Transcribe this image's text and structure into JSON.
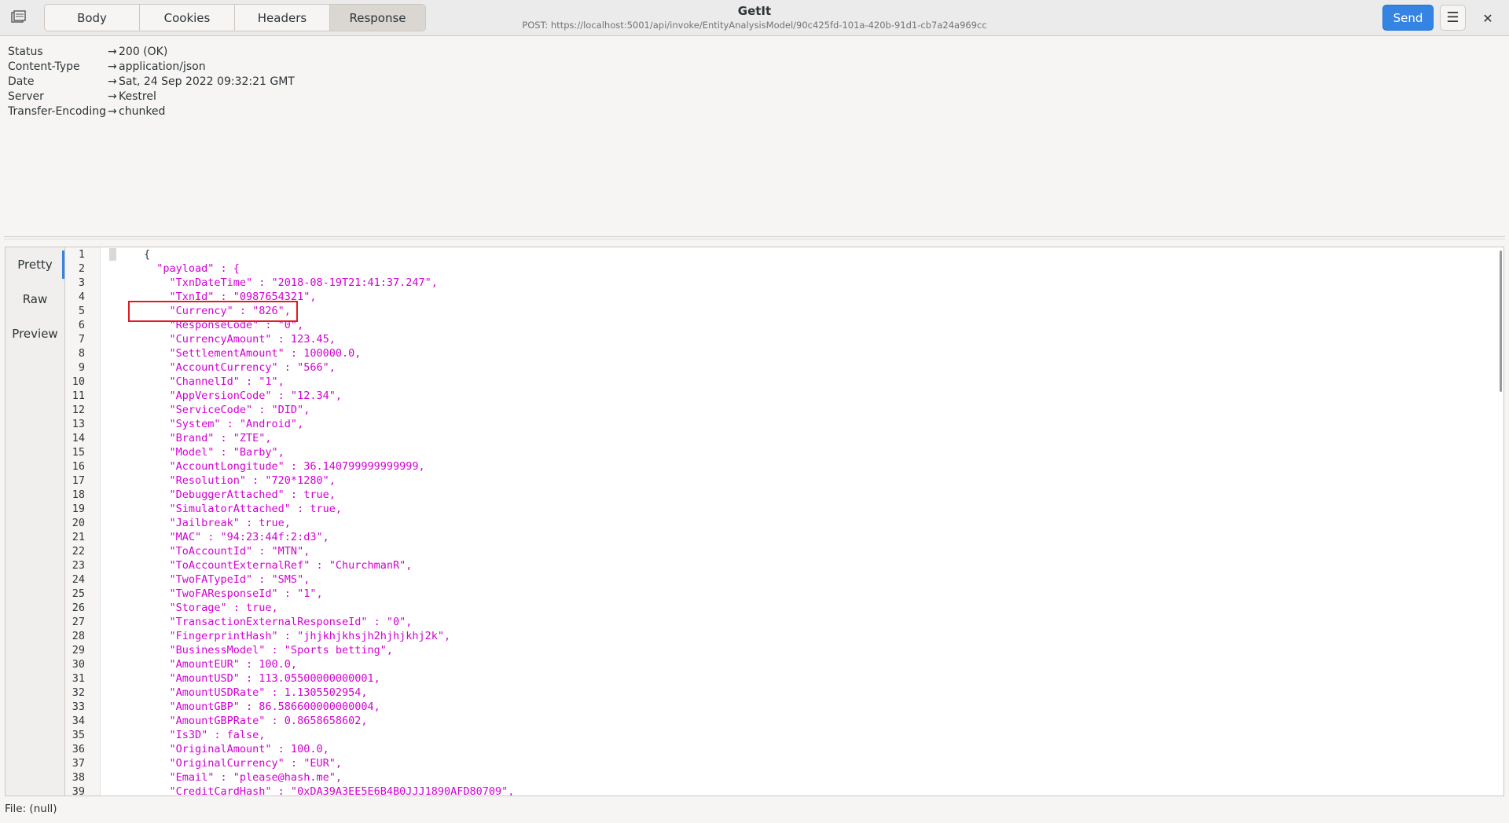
{
  "header": {
    "tabs": [
      "Body",
      "Cookies",
      "Headers",
      "Response"
    ],
    "active_tab": "Response",
    "title": "GetIt",
    "subtitle": "POST: https://localhost:5001/api/invoke/EntityAnalysisModel/90c425fd-101a-420b-91d1-cb7a24a969cc",
    "send_label": "Send",
    "menu_icon": "hamburger-icon",
    "close_icon": "close-icon",
    "app_icon": "app-icon"
  },
  "response_headers": [
    {
      "key": "Status",
      "value": "200 (OK)"
    },
    {
      "key": "Content-Type",
      "value": "application/json"
    },
    {
      "key": "Date",
      "value": "Sat, 24 Sep 2022 09:32:21 GMT"
    },
    {
      "key": "Server",
      "value": "Kestrel"
    },
    {
      "key": "Transfer-Encoding",
      "value": "chunked"
    }
  ],
  "arrow": "→",
  "view_switcher": [
    "Pretty",
    "Raw",
    "Preview"
  ],
  "active_view": "Pretty",
  "code_lines": [
    "{",
    "  \"payload\" : {",
    "    \"TxnDateTime\" : \"2018-08-19T21:41:37.247\",",
    "    \"TxnId\" : \"0987654321\",",
    "    \"Currency\" : \"826\",",
    "    \"ResponseCode\" : \"0\",",
    "    \"CurrencyAmount\" : 123.45,",
    "    \"SettlementAmount\" : 100000.0,",
    "    \"AccountCurrency\" : \"566\",",
    "    \"ChannelId\" : \"1\",",
    "    \"AppVersionCode\" : \"12.34\",",
    "    \"ServiceCode\" : \"DID\",",
    "    \"System\" : \"Android\",",
    "    \"Brand\" : \"ZTE\",",
    "    \"Model\" : \"Barby\",",
    "    \"AccountLongitude\" : 36.140799999999999,",
    "    \"Resolution\" : \"720*1280\",",
    "    \"DebuggerAttached\" : true,",
    "    \"SimulatorAttached\" : true,",
    "    \"Jailbreak\" : true,",
    "    \"MAC\" : \"94:23:44f:2:d3\",",
    "    \"ToAccountId\" : \"MTN\",",
    "    \"ToAccountExternalRef\" : \"ChurchmanR\",",
    "    \"TwoFATypeId\" : \"SMS\",",
    "    \"TwoFAResponseId\" : \"1\",",
    "    \"Storage\" : true,",
    "    \"TransactionExternalResponseId\" : \"0\",",
    "    \"FingerprintHash\" : \"jhjkhjkhsjh2hjhjkhj2k\",",
    "    \"BusinessModel\" : \"Sports betting\",",
    "    \"AmountEUR\" : 100.0,",
    "    \"AmountUSD\" : 113.05500000000001,",
    "    \"AmountUSDRate\" : 1.1305502954,",
    "    \"AmountGBP\" : 86.586600000000004,",
    "    \"AmountGBPRate\" : 0.8658658602,",
    "    \"Is3D\" : false,",
    "    \"OriginalAmount\" : 100.0,",
    "    \"OriginalCurrency\" : \"EUR\",",
    "    \"Email\" : \"please@hash.me\",",
    "    \"CreditCardHash\" : \"0xDA39A3EE5E6B4B0JJJ1890AFD80709\","
  ],
  "highlighted_line": 5,
  "status": "File: (null)",
  "colors": {
    "accent": "#3584e4",
    "json_string": "#d300d3",
    "highlight_box": "#e01b24"
  }
}
